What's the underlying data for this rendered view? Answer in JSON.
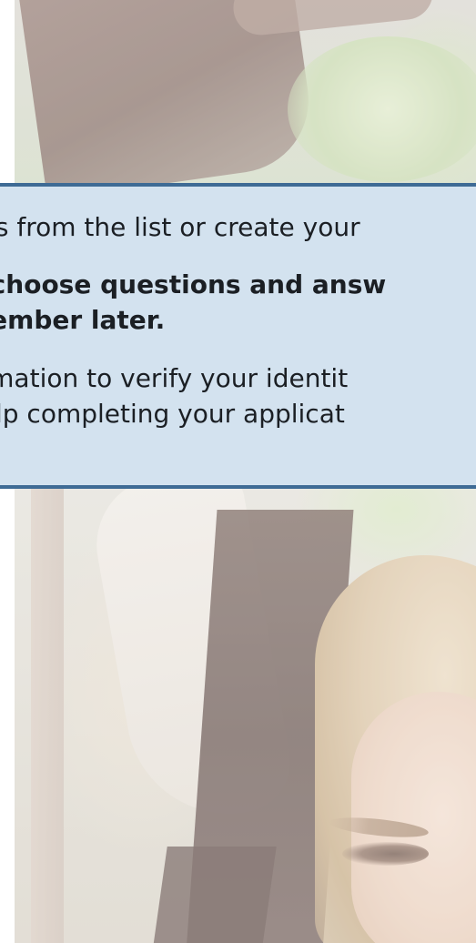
{
  "notice": {
    "line1": "ons from the list or create your",
    "line2": "u choose questions and answ",
    "line3": "member later.",
    "line4": "ormation to verify your identit",
    "line5": "help completing your applicat"
  },
  "background": {
    "image": "photo-woman-with-hat"
  }
}
